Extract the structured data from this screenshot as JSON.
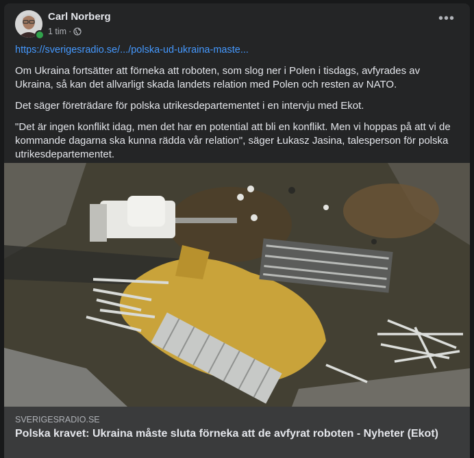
{
  "post": {
    "author": "Carl Norberg",
    "time": "1 tim",
    "separator": "·",
    "more_label": "•••",
    "link": "https://sverigesradio.se/.../polska-ud-ukraina-maste...",
    "paragraphs": [
      "Om Ukraina fortsätter att förneka att roboten, som slog ner i Polen i tisdags, avfyrades av Ukraina, så kan det allvarligt skada landets relation med Polen och resten av NATO.",
      "Det säger företrädare för polska utrikesdepartementet i en intervju med Ekot.",
      "\"Det är ingen konflikt idag, men det har en potential att bli en konflikt. Men vi hoppas på att vi de kommande dagarna ska kunna rädda vår relation\", säger Łukasz Jasina, talesperson för polska utrikesdepartementet."
    ]
  },
  "preview": {
    "domain": "SVERIGESRADIO.SE",
    "headline": "Polska kravet: Ukraina måste sluta förneka att de avfyrat roboten - Nyheter (Ekot)"
  },
  "colors": {
    "background": "#18191a",
    "card": "#242526",
    "link": "#4599ff",
    "online": "#31a24c",
    "preview_footer": "#3a3b3c"
  },
  "icons": {
    "avatar": "avatar",
    "globe": "globe-icon",
    "more": "more-options-icon"
  }
}
